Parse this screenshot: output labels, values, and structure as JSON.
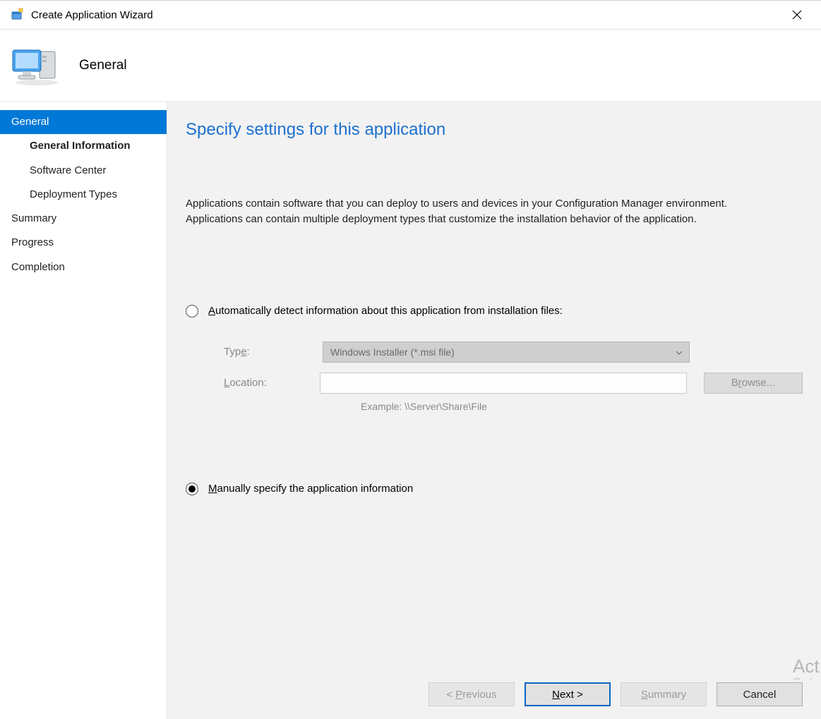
{
  "window": {
    "title": "Create Application Wizard"
  },
  "header": {
    "page_title": "General"
  },
  "sidebar": {
    "items": [
      {
        "label": "General",
        "active": true,
        "sub": false
      },
      {
        "label": "General Information",
        "active": false,
        "sub": true,
        "bold": true
      },
      {
        "label": "Software Center",
        "active": false,
        "sub": true
      },
      {
        "label": "Deployment Types",
        "active": false,
        "sub": true
      },
      {
        "label": "Summary",
        "active": false,
        "sub": false
      },
      {
        "label": "Progress",
        "active": false,
        "sub": false
      },
      {
        "label": "Completion",
        "active": false,
        "sub": false
      }
    ]
  },
  "content": {
    "heading": "Specify settings for this application",
    "description": "Applications contain software that you can deploy to users and devices in your Configuration Manager environment. Applications can contain multiple deployment types that customize the installation behavior of the application.",
    "radio_auto": {
      "prefix": "A",
      "rest": "utomatically detect information about this application from installation files:"
    },
    "radio_manual": {
      "prefix": "M",
      "rest": "anually specify the application information"
    },
    "type_label_prefix": "Typ",
    "type_label_u": "e",
    "type_label_suffix": ":",
    "type_value": "Windows Installer (*.msi file)",
    "location_label_u": "L",
    "location_label_rest": "ocation:",
    "example_hint": "Example: \\\\Server\\Share\\File",
    "browse_prefix": "B",
    "browse_u": "r",
    "browse_suffix": "owse..."
  },
  "footer": {
    "previous": {
      "lt": "< ",
      "u": "P",
      "rest": "revious"
    },
    "next": {
      "u": "N",
      "rest": "ext >"
    },
    "summary": {
      "u": "S",
      "rest": "ummary"
    },
    "cancel": "Cancel"
  },
  "watermark": {
    "line1": "Act",
    "line2": "Go t"
  }
}
